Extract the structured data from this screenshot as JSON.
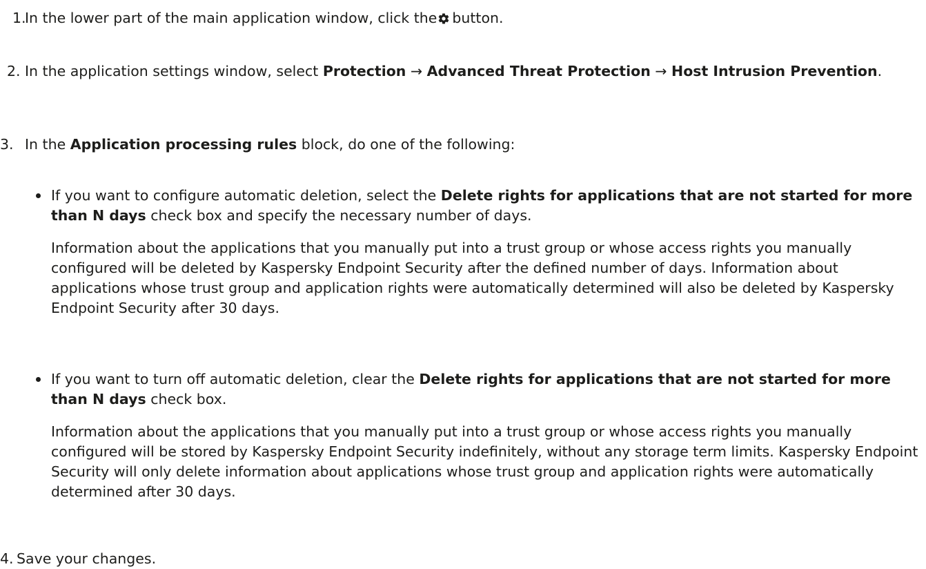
{
  "step1": {
    "num": "1.",
    "before": "In the lower part of the main application window, click the",
    "icon": "gear-icon",
    "after": "button."
  },
  "step2": {
    "num": "2.",
    "lead": "In the application settings window, select",
    "path1": "Protection",
    "arrow1": "→",
    "path2": "Advanced Threat Protection",
    "arrow2": "→",
    "path3": "Host Intrusion Prevention",
    "end": "."
  },
  "step3": {
    "num": "3.",
    "lead": "In the",
    "block": "Application processing rules",
    "tail": "block, do one of the following:",
    "bullet1": {
      "lead": "If you want to configure automatic deletion, select the",
      "checkbox": "Delete rights for applications that are not started for more than N days",
      "tail": "check box and specify the necessary number of days.",
      "para": "Information about the applications that you manually put into a trust group or whose access rights you manually configured will be deleted by Kaspersky Endpoint Security after the defined number of days. Information about applications whose trust group and application rights were automatically determined will also be deleted by Kaspersky Endpoint Security after 30 days."
    },
    "bullet2": {
      "lead": "If you want to turn off automatic deletion, clear the",
      "checkbox": "Delete rights for applications that are not started for more than N days",
      "tail": "check box.",
      "para": "Information about the applications that you manually put into a trust group or whose access rights you manually configured will be stored by Kaspersky Endpoint Security indefinitely, without any storage term limits. Kaspersky Endpoint Security will only delete information about applications whose trust group and application rights were automatically determined after 30 days."
    }
  },
  "step4": {
    "num": "4.",
    "text": "Save your changes."
  }
}
